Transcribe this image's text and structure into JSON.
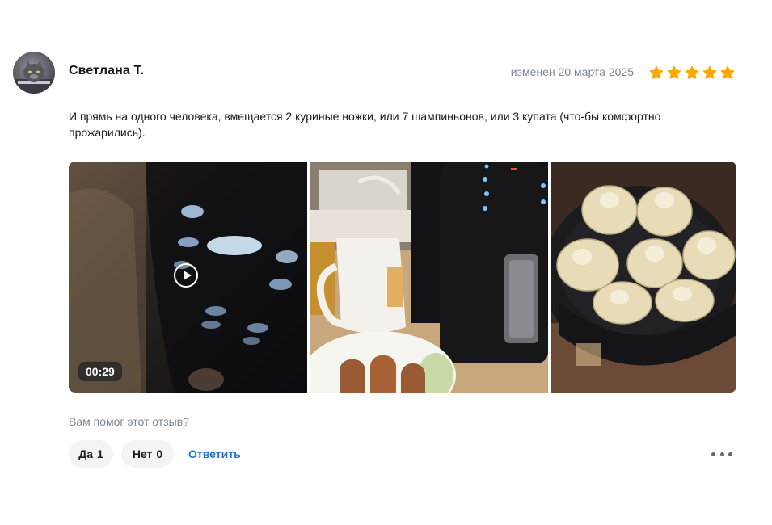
{
  "review": {
    "author": "Светлана Т.",
    "date": "изменен 20 марта 2025",
    "rating": 5,
    "text": "И прямь на одного человека, вмещается 2 куриные ножки, или 7 шампиньонов, или 3 купата (что-бы комфортно прожарились).",
    "media": {
      "video_duration": "00:29"
    },
    "helpful": {
      "question": "Вам помог этот отзыв?",
      "yes_label": "Да",
      "yes_count": "1",
      "no_label": "Нет",
      "no_count": "0",
      "reply_label": "Ответить"
    }
  },
  "colors": {
    "star": "#ffa600",
    "link": "#1f6fd6",
    "muted": "#7b8795",
    "pill_bg": "#f3f4f6"
  },
  "icons": [
    "avatar-photo",
    "star-icon",
    "play-icon",
    "more-dots-icon"
  ]
}
